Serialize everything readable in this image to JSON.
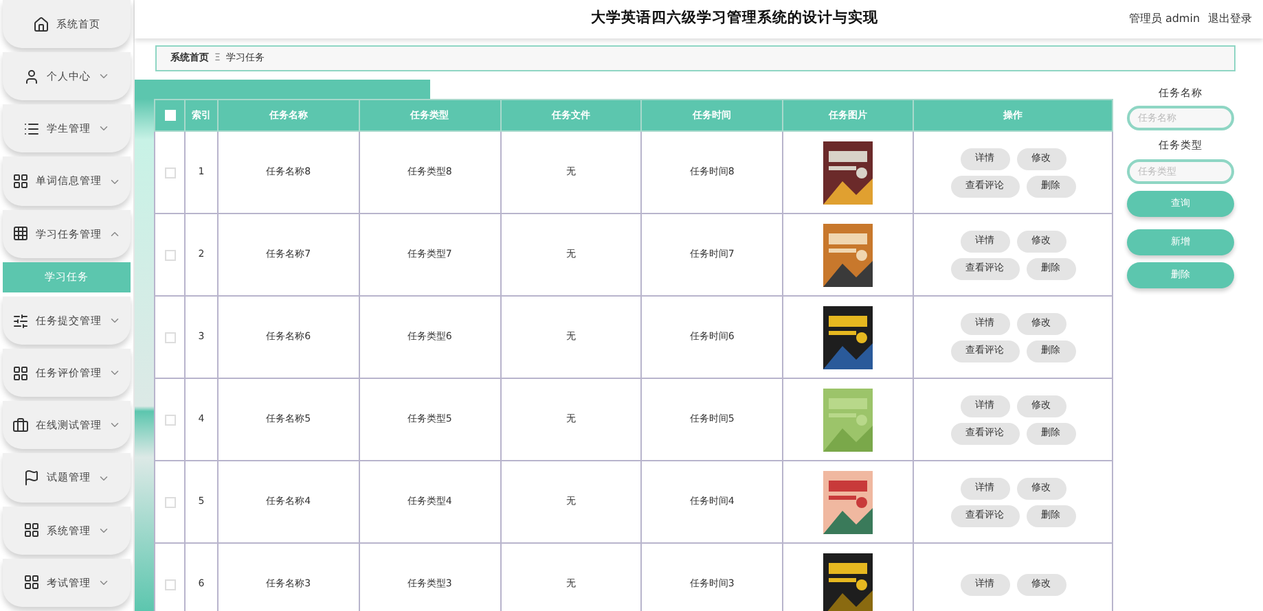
{
  "header": {
    "title": "大学英语四六级学习管理系统的设计与实现",
    "user": "管理员 admin",
    "logout": "退出登录"
  },
  "sidebar": {
    "items": [
      {
        "label": "系统首页",
        "kind": "home"
      },
      {
        "label": "个人中心",
        "kind": "user",
        "expanded": false
      },
      {
        "label": "学生管理",
        "kind": "list",
        "expanded": false
      },
      {
        "label": "单词信息管理",
        "kind": "grid",
        "expanded": false
      },
      {
        "label": "学习任务管理",
        "kind": "table",
        "expanded": true,
        "children": [
          {
            "label": "学习任务",
            "selected": true
          }
        ]
      },
      {
        "label": "任务提交管理",
        "kind": "sliders",
        "expanded": false
      },
      {
        "label": "任务评价管理",
        "kind": "grid",
        "expanded": false
      },
      {
        "label": "在线测试管理",
        "kind": "bag",
        "expanded": false
      },
      {
        "label": "试题管理",
        "kind": "flag",
        "expanded": false
      },
      {
        "label": "系统管理",
        "kind": "grid",
        "expanded": false
      },
      {
        "label": "考试管理",
        "kind": "grid",
        "expanded": false
      }
    ]
  },
  "breadcrumb": [
    "系统首页",
    "学习任务"
  ],
  "breadcrumb_separator": "Ξ",
  "table": {
    "select_all_checked": false,
    "columns": [
      "索引",
      "任务名称",
      "任务类型",
      "任务文件",
      "任务时间",
      "任务图片",
      "操作"
    ],
    "rows": [
      {
        "index": "1",
        "name": "任务名称8",
        "type": "任务类型8",
        "file": "无",
        "time": "任务时间8",
        "checked": false,
        "actions": [
          "详情",
          "修改",
          "查看评论",
          "删除"
        ]
      },
      {
        "index": "2",
        "name": "任务名称7",
        "type": "任务类型7",
        "file": "无",
        "time": "任务时间7",
        "checked": false,
        "actions": [
          "详情",
          "修改",
          "查看评论",
          "删除"
        ]
      },
      {
        "index": "3",
        "name": "任务名称6",
        "type": "任务类型6",
        "file": "无",
        "time": "任务时间6",
        "checked": false,
        "actions": [
          "详情",
          "修改",
          "查看评论",
          "删除"
        ]
      },
      {
        "index": "4",
        "name": "任务名称5",
        "type": "任务类型5",
        "file": "无",
        "time": "任务时间5",
        "checked": false,
        "actions": [
          "详情",
          "修改",
          "查看评论",
          "删除"
        ]
      },
      {
        "index": "5",
        "name": "任务名称4",
        "type": "任务类型4",
        "file": "无",
        "time": "任务时间4",
        "checked": false,
        "actions": [
          "详情",
          "修改",
          "查看评论",
          "删除"
        ]
      },
      {
        "index": "6",
        "name": "任务名称3",
        "type": "任务类型3",
        "file": "无",
        "time": "任务时间3",
        "checked": false,
        "actions": [
          "详情",
          "修改"
        ]
      }
    ]
  },
  "search": {
    "fields": [
      {
        "label": "任务名称",
        "placeholder": "任务名称"
      },
      {
        "label": "任务类型",
        "placeholder": "任务类型"
      }
    ],
    "buttons": [
      "查询",
      "新增",
      "删除"
    ]
  }
}
